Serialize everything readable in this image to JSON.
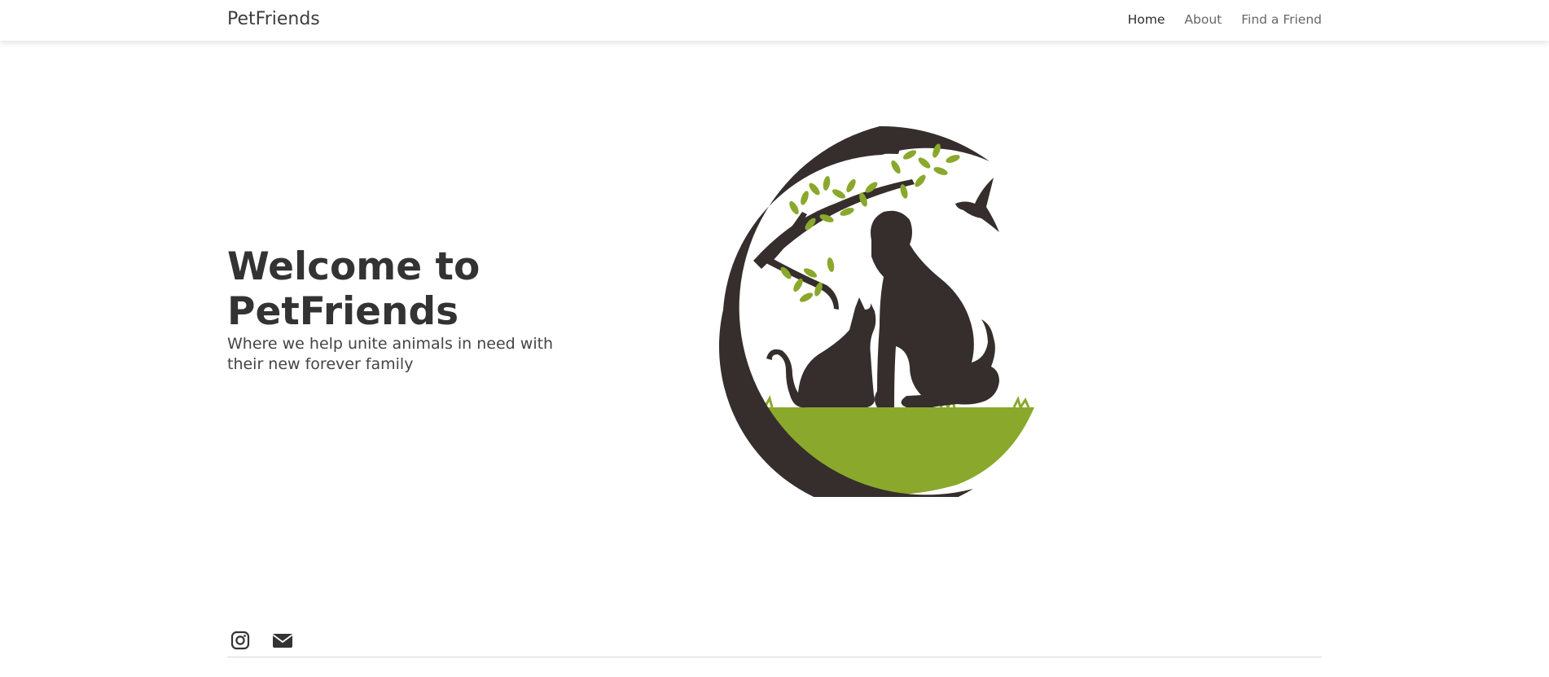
{
  "navbar": {
    "brand": "PetFriends",
    "links": [
      {
        "label": "Home",
        "active": true
      },
      {
        "label": "About",
        "active": false
      },
      {
        "label": "Find a Friend",
        "active": false
      }
    ]
  },
  "hero": {
    "title": "Welcome to PetFriends",
    "subtitle": "Where we help unite animals in need with their new forever family",
    "logo_colors": {
      "dark": "#352e2d",
      "green": "#8aa82b"
    }
  },
  "footer": {
    "icons": [
      "instagram-icon",
      "envelope-icon"
    ]
  }
}
